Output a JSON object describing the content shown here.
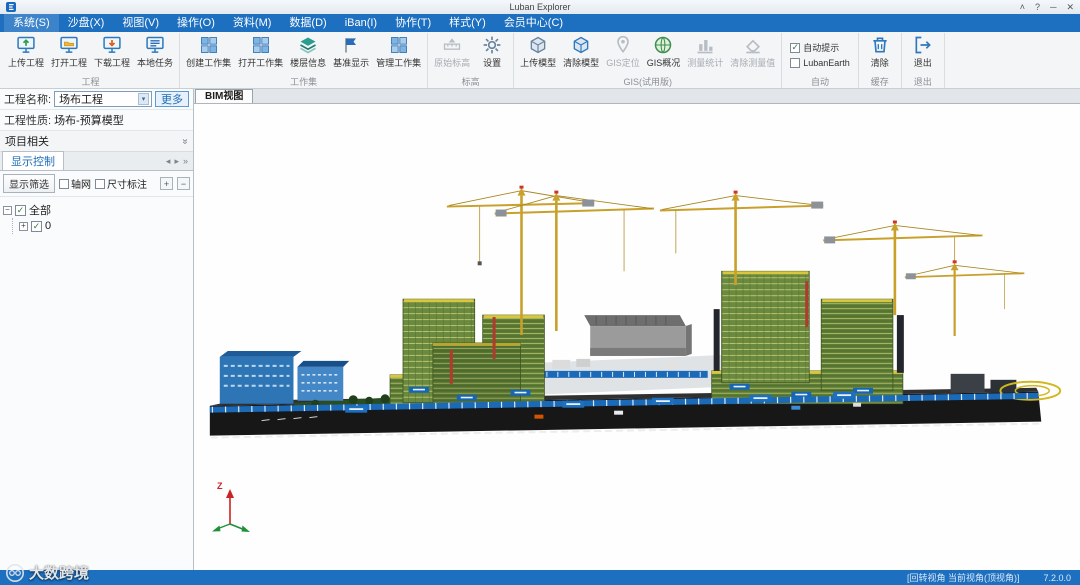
{
  "window": {
    "title": "Luban Explorer"
  },
  "glyphs": {
    "dropdown": "▾",
    "left_arrow": "◂",
    "right_arrow": "▸",
    "double_chevron": "»",
    "plus": "+",
    "minus": "−",
    "check": "✓",
    "chevron_up": "˄",
    "help": "?",
    "minimize": "─",
    "close": "✕",
    "tree_collapse": "−",
    "tree_expand": "+"
  },
  "menu": {
    "items": [
      "系统(S)",
      "沙盘(X)",
      "视图(V)",
      "操作(O)",
      "资料(M)",
      "数据(D)",
      "iBan(I)",
      "协作(T)",
      "样式(Y)",
      "会员中心(C)"
    ]
  },
  "ribbon": {
    "groups": [
      {
        "label": "工程",
        "buttons": [
          {
            "label": "上传工程"
          },
          {
            "label": "打开工程"
          },
          {
            "label": "下载工程"
          },
          {
            "label": "本地任务"
          }
        ]
      },
      {
        "label": "工作集",
        "buttons": [
          {
            "label": "创建工作集"
          },
          {
            "label": "打开工作集"
          },
          {
            "label": "楼层信息"
          },
          {
            "label": "基准显示"
          },
          {
            "label": "管理工作集"
          }
        ]
      },
      {
        "label": "标高",
        "buttons": [
          {
            "label": "原始标高",
            "disabled": true
          },
          {
            "label": "设置"
          }
        ]
      },
      {
        "label": "GIS(试用版)",
        "buttons": [
          {
            "label": "上传模型"
          },
          {
            "label": "清除模型"
          },
          {
            "label": "GIS定位",
            "disabled": true
          },
          {
            "label": "GIS概况"
          },
          {
            "label": "测量统计",
            "disabled": true
          },
          {
            "label": "清除测量值",
            "disabled": true
          }
        ]
      },
      {
        "label": "自动",
        "checkboxes": [
          {
            "label": "自动提示",
            "checked": true
          },
          {
            "label": "LubanEarth",
            "checked": false
          }
        ]
      },
      {
        "label": "缓存",
        "buttons": [
          {
            "label": "清除"
          }
        ]
      },
      {
        "label": "退出",
        "buttons": [
          {
            "label": "退出"
          }
        ]
      }
    ]
  },
  "panel": {
    "project_name_label": "工程名称:",
    "project_name_value": "场布工程",
    "more_button": "更多",
    "project_type_label": "工程性质:",
    "project_type_value": "场布-预算模型",
    "project_related_label": "项目相关",
    "display_control_tab": "显示控制",
    "filter_button": "显示筛选",
    "grid_label": "轴网",
    "grid_checked": false,
    "dimension_label": "尺寸标注",
    "dimension_checked": false,
    "tree": {
      "root_label": "全部",
      "child_label": "0"
    }
  },
  "viewport": {
    "tab": "BIM视图",
    "axis_z_label": "Z"
  },
  "status": {
    "view_hint": "[回转视角 当前视角(顶视角)]",
    "version": "7.2.0.0"
  },
  "watermark": {
    "text": "大数跨境"
  }
}
